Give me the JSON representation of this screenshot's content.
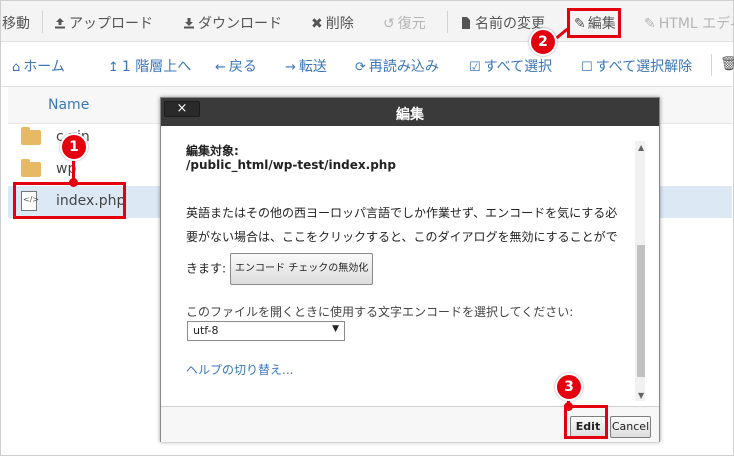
{
  "toolbar_top": {
    "move": "移動",
    "upload": "アップロード",
    "download": "ダウンロード",
    "delete": "削除",
    "restore": "復元",
    "rename": "名前の変更",
    "edit": "編集",
    "html_editor": "HTML エディ"
  },
  "toolbar_nav": {
    "home": "ホーム",
    "up_one": "1 階層上へ",
    "back": "戻る",
    "forward": "転送",
    "reload": "再読み込み",
    "select_all": "すべて選択",
    "deselect_all": "すべて選択解除"
  },
  "file_list": {
    "column_name": "Name",
    "rows": [
      {
        "name": "cgi-bin",
        "visible": "c    pin"
      },
      {
        "name": "wp",
        "visible": "wp"
      },
      {
        "name": "index.php",
        "visible": "index.php"
      }
    ]
  },
  "dialog": {
    "title": "編集",
    "close": "×",
    "target_label": "編集対象:",
    "target_path": "/public_html/wp-test/index.php",
    "notice_line1": "英語またはその他の西ヨーロッパ言語でしか作業せず、エンコードを気にする必",
    "notice_line2": "要がない場合は、ここをクリックすると、このダイアログを無効にすることがで",
    "notice_line3": "きます:",
    "encoding_check_button": "エンコード チェックの無効化",
    "select_encoding_label": "このファイルを開くときに使用する文字エンコードを選択してください:",
    "encoding_value": "utf-8",
    "help_toggle": "ヘルプの切り替え...",
    "edit_button": "Edit",
    "cancel_button": "Cancel"
  },
  "annotations": {
    "step1": "1",
    "step2": "2",
    "step3": "3"
  },
  "colors": {
    "annotation_red": "#e3000f",
    "link_blue": "#3b77b8",
    "dialog_title_bg": "#3a3a3a",
    "selected_row": "#dce9f5"
  }
}
